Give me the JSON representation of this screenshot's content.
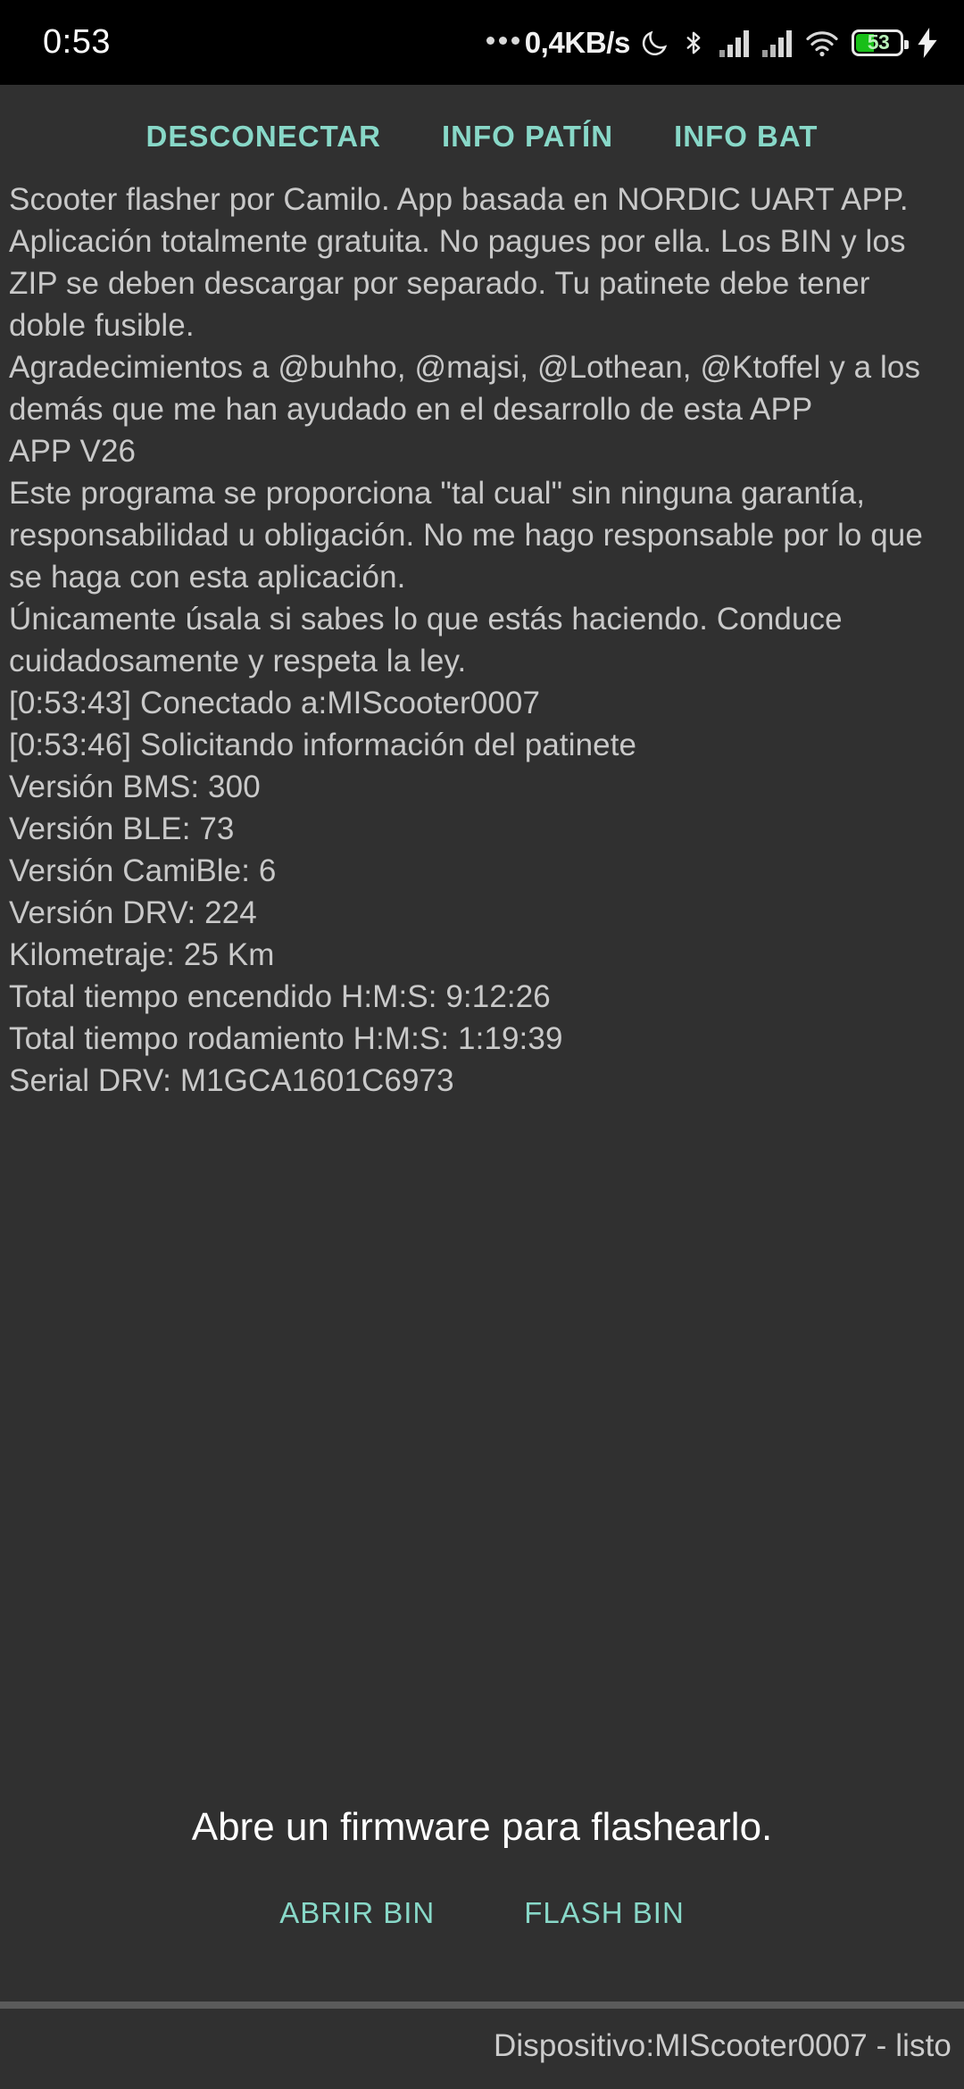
{
  "status_bar": {
    "clock": "0:53",
    "network_speed": "0,4KB/s",
    "battery_percent": "53",
    "icons": [
      "dnd-moon-icon",
      "bluetooth-icon",
      "cellular-signal-icon",
      "cellular-signal-icon",
      "wifi-icon",
      "battery-icon",
      "charging-bolt-icon"
    ]
  },
  "tabs": [
    {
      "label": "DESCONECTAR",
      "name": "tab-desconectar"
    },
    {
      "label": "INFO PATÍN",
      "name": "tab-info-patin"
    },
    {
      "label": "INFO BAT",
      "name": "tab-info-bat"
    }
  ],
  "log": {
    "lines": [
      "Scooter flasher por Camilo. App basada en NORDIC UART APP. Aplicación totalmente gratuita. No pagues por ella. Los BIN y los ZIP se deben descargar por separado. Tu patinete debe tener doble fusible.",
      "Agradecimientos a @buhho, @majsi, @Lothean, @Ktoffel y a los demás que me han ayudado en el desarrollo de esta APP",
      "APP V26",
      "Este programa se proporciona \"tal cual\" sin ninguna garantía, responsabilidad u obligación. No me hago responsable por lo que se haga con esta aplicación.",
      "Únicamente úsala si sabes lo que estás haciendo. Conduce cuidadosamente y respeta la ley.",
      "[0:53:43] Conectado a:MIScooter0007",
      "[0:53:46] Solicitando información del patinete",
      "Versión BMS: 300",
      "Versión BLE: 73",
      "Versión CamiBle: 6",
      "Versión DRV: 224",
      "Kilometraje: 25 Km",
      "Total tiempo encendido H:M:S: 9:12:26",
      "Total tiempo rodamiento H:M:S: 1:19:39",
      "Serial DRV: M1GCA1601C6973"
    ]
  },
  "flash": {
    "status_text": "Abre un firmware para flashearlo.",
    "open_button": "ABRIR BIN",
    "flash_button": "FLASH BIN"
  },
  "bottom": {
    "device_status": "Dispositivo:MIScooter0007 - listo"
  },
  "colors": {
    "accent": "#88d8c8",
    "background": "#303030",
    "statusbar_bg": "#000000",
    "text": "#c9c9c9",
    "battery_green": "#19bf19"
  }
}
